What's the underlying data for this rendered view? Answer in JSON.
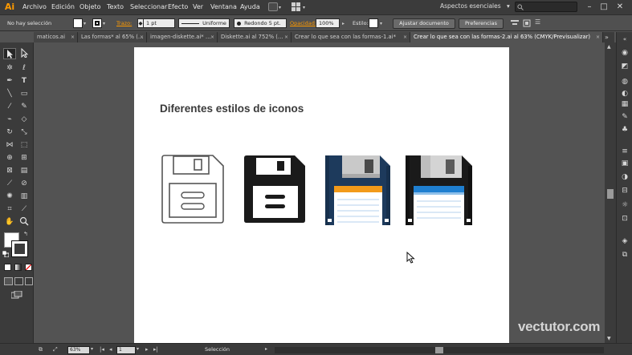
{
  "app": {
    "logo": "Ai"
  },
  "menu": [
    "Archivo",
    "Edición",
    "Objeto",
    "Texto",
    "Seleccionar",
    "Efecto",
    "Ver",
    "Ventana",
    "Ayuda"
  ],
  "workspace": {
    "label": "Aspectos esenciales",
    "arrow": "▾"
  },
  "window_controls": {
    "minimize": "–",
    "maximize": "□",
    "close": "✕"
  },
  "control_bar": {
    "selection_label": "No hay selección",
    "stroke_label": "Trazo:",
    "stroke_weight": "1 pt",
    "stroke_profile": "Uniforme",
    "brush": "Redondo 5 pt.",
    "opacity_label": "Opacidad:",
    "opacity_value": "100%",
    "style_label": "Estilo:",
    "doc_setup_button": "Ajustar documento",
    "preferences_button": "Preferencias"
  },
  "tabs": [
    {
      "label": "maticos.ai",
      "active": false
    },
    {
      "label": "Las formas* al 65% (…",
      "active": false
    },
    {
      "label": "imagen-diskette.ai* …",
      "active": false
    },
    {
      "label": "Diskette.ai al 752% (…",
      "active": false
    },
    {
      "label": "Crear lo que sea con las formas-1.ai*",
      "active": false
    },
    {
      "label": "Crear lo que sea con las formas-2.ai al 63% (CMYK/Previsualizar)",
      "active": true
    }
  ],
  "tab_close_glyph": "×",
  "tab_overflow": "»",
  "artboard": {
    "heading": "Diferentes estilos de iconos",
    "icons": [
      {
        "name": "floppy-outline-icon",
        "style": "outline"
      },
      {
        "name": "floppy-solid-icon",
        "style": "solid"
      },
      {
        "name": "floppy-flat-orange-icon",
        "style": "flat",
        "accent": "#f29a1a",
        "shutter": "#c9c9c9",
        "body": "#1d3a5c"
      },
      {
        "name": "floppy-flat-blue-icon",
        "style": "flat",
        "accent": "#1f7fd0",
        "shutter": "#c9c9c9",
        "body": "#1a1a1a"
      }
    ]
  },
  "status_bar": {
    "zoom": "63%",
    "page": "1",
    "tool_label": "Selección"
  },
  "watermark": "vectutor.com",
  "colors": {
    "menubar": "#3b3b3b",
    "panel": "#3b3b3b",
    "canvas": "#535353",
    "accent_logo": "#ff9a00",
    "stroke_label": "#ff9a00"
  }
}
